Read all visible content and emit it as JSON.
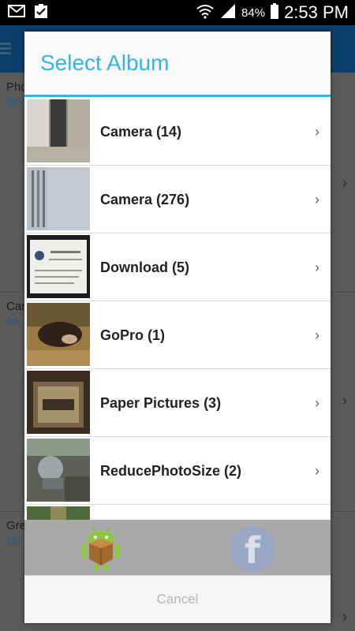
{
  "status_bar": {
    "battery_percent": "84%",
    "time": "2:53 PM",
    "icons": [
      "gmail-icon",
      "clipboard-icon",
      "wifi-icon",
      "signal-icon",
      "battery-icon"
    ]
  },
  "background_list": {
    "rows": [
      {
        "title": "Pho",
        "sub": "29 k"
      },
      {
        "title": "Car",
        "sub": "8 ki"
      },
      {
        "title": "Gre",
        "sub": "187"
      }
    ]
  },
  "dialog": {
    "title": "Select Album",
    "albums": [
      {
        "label": "Camera (14)"
      },
      {
        "label": "Camera (276)"
      },
      {
        "label": "Download (5)"
      },
      {
        "label": "GoPro (1)"
      },
      {
        "label": "Paper Pictures (3)"
      },
      {
        "label": "ReducePhotoSize (2)"
      }
    ],
    "share_icons": [
      "android-icon",
      "facebook-icon"
    ],
    "cancel_label": "Cancel"
  },
  "colors": {
    "accent": "#33b5e5",
    "share_bar": "#a9a9a9",
    "cancel_text": "#b5b5b5"
  }
}
